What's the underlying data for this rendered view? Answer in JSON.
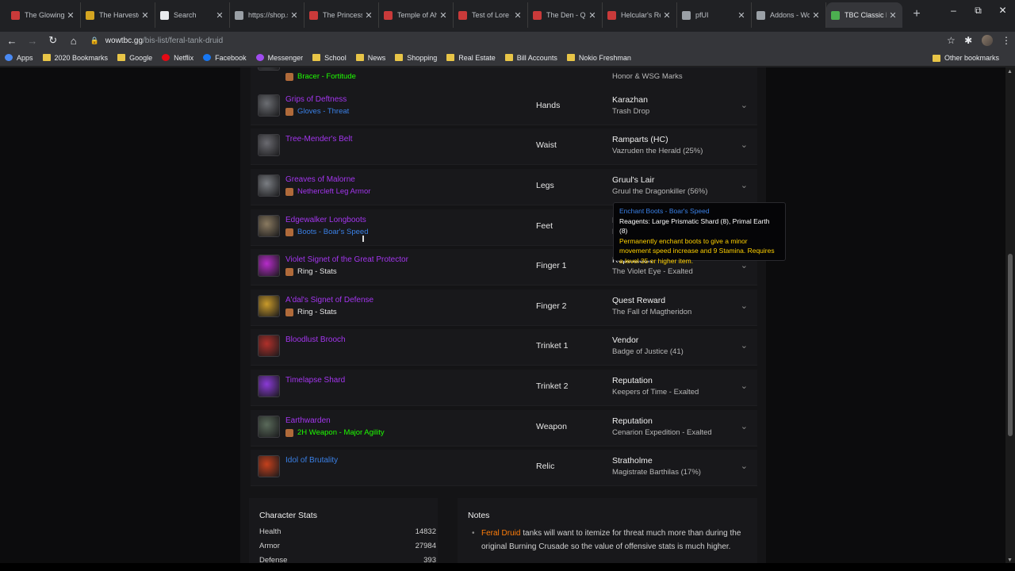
{
  "tabs": [
    {
      "label": "The Glowing S",
      "icon": "wowhead-icon",
      "color": "#c93a3a"
    },
    {
      "label": "The Harvester",
      "icon": "wow-icon",
      "color": "#d4a521"
    },
    {
      "label": "Search",
      "icon": "doc-icon",
      "color": "#e8eaed"
    },
    {
      "label": "https://shop.s",
      "icon": "globe-icon",
      "color": "#9aa0a6"
    },
    {
      "label": "The Princess T",
      "icon": "wowhead-icon",
      "color": "#c93a3a"
    },
    {
      "label": "Temple of Ah",
      "icon": "wowhead-icon",
      "color": "#c93a3a"
    },
    {
      "label": "Test of Lore -",
      "icon": "wowhead-icon",
      "color": "#c93a3a"
    },
    {
      "label": "The Den - Qu",
      "icon": "wowhead-icon",
      "color": "#c93a3a"
    },
    {
      "label": "Helcular's Re",
      "icon": "wowhead-icon",
      "color": "#c93a3a"
    },
    {
      "label": "pfUI",
      "icon": "github-icon",
      "color": "#9aa0a6"
    },
    {
      "label": "Addons - Wo",
      "icon": "curse-icon",
      "color": "#9aa0a6"
    },
    {
      "label": "TBC Classic Fe",
      "icon": "wowtbc-icon",
      "color": "#4caf50",
      "active": true
    }
  ],
  "url": {
    "host": "wowtbc.gg",
    "path": "/bis-list/feral-tank-druid"
  },
  "bookmarks": [
    {
      "label": "Apps",
      "icon": "apps-icon"
    },
    {
      "label": "2020 Bookmarks",
      "icon": "folder-icon"
    },
    {
      "label": "Google",
      "icon": "folder-icon"
    },
    {
      "label": "Netflix",
      "icon": "netflix-icon"
    },
    {
      "label": "Facebook",
      "icon": "facebook-icon"
    },
    {
      "label": "Messenger",
      "icon": "messenger-icon"
    },
    {
      "label": "School",
      "icon": "folder-icon"
    },
    {
      "label": "News",
      "icon": "folder-icon"
    },
    {
      "label": "Shopping",
      "icon": "folder-icon"
    },
    {
      "label": "Real Estate",
      "icon": "folder-icon"
    },
    {
      "label": "Bill Accounts",
      "icon": "folder-icon"
    },
    {
      "label": "Nokio Freshman",
      "icon": "folder-icon"
    }
  ],
  "other_bookmarks": "Other bookmarks",
  "items": [
    {
      "name": "",
      "enchant": "Bracer - Fortitude",
      "enchant_quality": "green",
      "slot": "Wrist",
      "source": "",
      "source_sub": "Honor & WSG Marks",
      "icon_color": "#5a5d62"
    },
    {
      "name": "Grips of Deftness",
      "quality": "epic",
      "enchant": "Gloves - Threat",
      "enchant_quality": "rare",
      "slot": "Hands",
      "source": "Karazhan",
      "source_sub": "Trash Drop",
      "icon_color": "#6b6d72"
    },
    {
      "name": "Tree-Mender's Belt",
      "quality": "epic",
      "enchant": "",
      "slot": "Waist",
      "source": "Ramparts (HC)",
      "source_sub": "Vazruden the Herald (25%)",
      "icon_color": "#6a6a70"
    },
    {
      "name": "Greaves of Malorne",
      "quality": "epic",
      "enchant": "Nethercleft Leg Armor",
      "enchant_quality": "epic",
      "slot": "Legs",
      "source": "Gruul's Lair",
      "source_sub": "Gruul the Dragonkiller (56%)",
      "icon_color": "#7a7d82"
    },
    {
      "name": "Edgewalker Longboots",
      "quality": "epic",
      "enchant": "Boots - Boar's Speed",
      "enchant_quality": "rare",
      "slot": "Feet",
      "source": "Karazhan",
      "source_sub": "Moroes (16%)",
      "icon_color": "#8a7a60"
    },
    {
      "name": "Violet Signet of the Great Protector",
      "quality": "epic",
      "enchant": "Ring - Stats",
      "enchant_quality": "white",
      "slot": "Finger 1",
      "source": "Reputation",
      "source_sub": "The Violet Eye - Exalted",
      "icon_color": "#b62cc9"
    },
    {
      "name": "A'dal's Signet of Defense",
      "quality": "epic",
      "enchant": "Ring - Stats",
      "enchant_quality": "white",
      "slot": "Finger 2",
      "source": "Quest Reward",
      "source_sub": "The Fall of Magtheridon",
      "icon_color": "#c99a2a"
    },
    {
      "name": "Bloodlust Brooch",
      "quality": "epic",
      "enchant": "",
      "slot": "Trinket 1",
      "source": "Vendor",
      "source_sub": "Badge of Justice (41)",
      "icon_color": "#b0302a"
    },
    {
      "name": "Timelapse Shard",
      "quality": "epic",
      "enchant": "",
      "slot": "Trinket 2",
      "source": "Reputation",
      "source_sub": "Keepers of Time - Exalted",
      "icon_color": "#8a3ad6"
    },
    {
      "name": "Earthwarden",
      "quality": "epic",
      "enchant": "2H Weapon - Major Agility",
      "enchant_quality": "green",
      "slot": "Weapon",
      "source": "Reputation",
      "source_sub": "Cenarion Expedition - Exalted",
      "icon_color": "#5a6a5a"
    },
    {
      "name": "Idol of Brutality",
      "quality": "rare",
      "enchant": "",
      "slot": "Relic",
      "source": "Stratholme",
      "source_sub": "Magistrate Barthilas (17%)",
      "icon_color": "#c4401c"
    }
  ],
  "tooltip": {
    "title": "Enchant Boots - Boar's Speed",
    "reagents": "Reagents: Large Prismatic Shard (8), Primal Earth (8)",
    "description": "Permanently enchant boots to give a minor movement speed increase and 9 Stamina. Requires a level 35 or higher item."
  },
  "character_stats": {
    "title": "Character Stats",
    "rows": [
      {
        "label": "Health",
        "value": "14832"
      },
      {
        "label": "Armor",
        "value": "27984"
      },
      {
        "label": "Defense",
        "value": "393"
      }
    ]
  },
  "notes": {
    "title": "Notes",
    "highlight": "Feral Druid",
    "text": " tanks will want to itemize for threat much more than during the original Burning Crusade so the value of offensive stats is much higher."
  }
}
